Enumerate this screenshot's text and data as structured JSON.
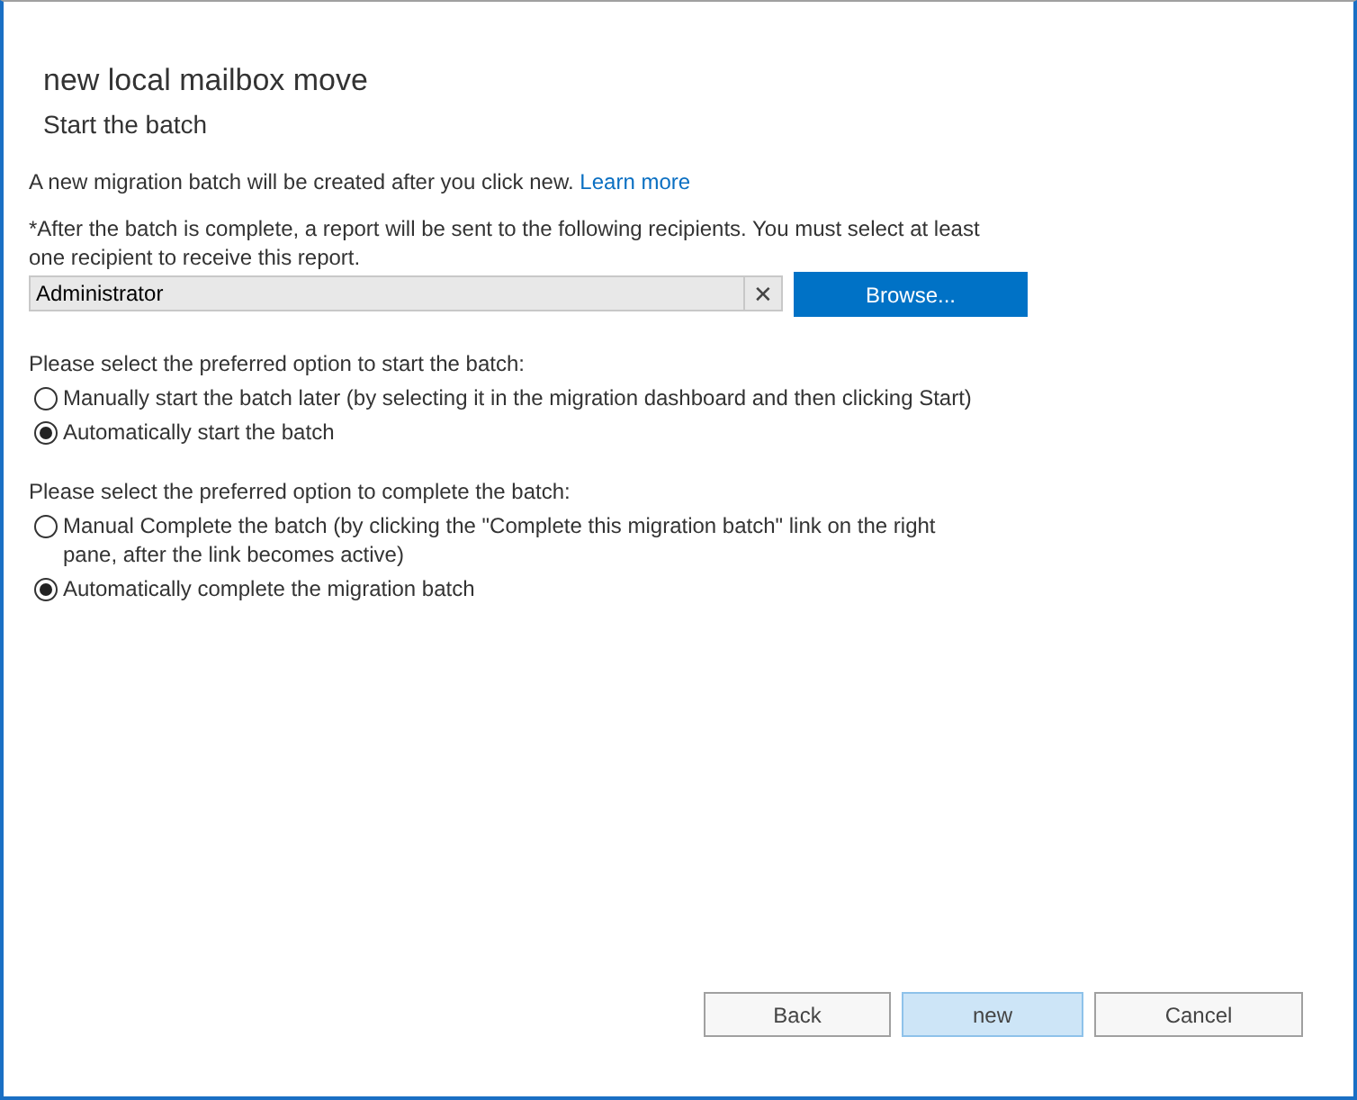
{
  "dialog": {
    "title": "new local mailbox move",
    "subtitle": "Start the batch"
  },
  "intro": {
    "text": "A new migration batch will be created after you click new.",
    "link": "Learn more"
  },
  "recipients": {
    "note": "*After the batch is complete, a report will be sent to the following recipients. You must select at least one recipient to receive this report.",
    "value": "Administrator",
    "clear": "✕",
    "browse": "Browse..."
  },
  "option_groups": [
    {
      "prompt": "Please select the preferred option to start the batch:",
      "options": [
        {
          "label": "Manually start the batch later (by selecting it in the migration dashboard and then clicking Start)",
          "selected": false
        },
        {
          "label": "Automatically start the batch",
          "selected": true
        }
      ]
    },
    {
      "prompt": "Please select the preferred option to complete the batch:",
      "options": [
        {
          "label": "Manual Complete the batch (by clicking the \"Complete this migration batch\" link on the right pane, after the link becomes active)",
          "selected": false
        },
        {
          "label": "Automatically complete the migration batch",
          "selected": true
        }
      ]
    }
  ],
  "buttons": [
    {
      "label": "Back",
      "default": false
    },
    {
      "label": "new",
      "default": true
    },
    {
      "label": "Cancel",
      "default": false
    }
  ]
}
